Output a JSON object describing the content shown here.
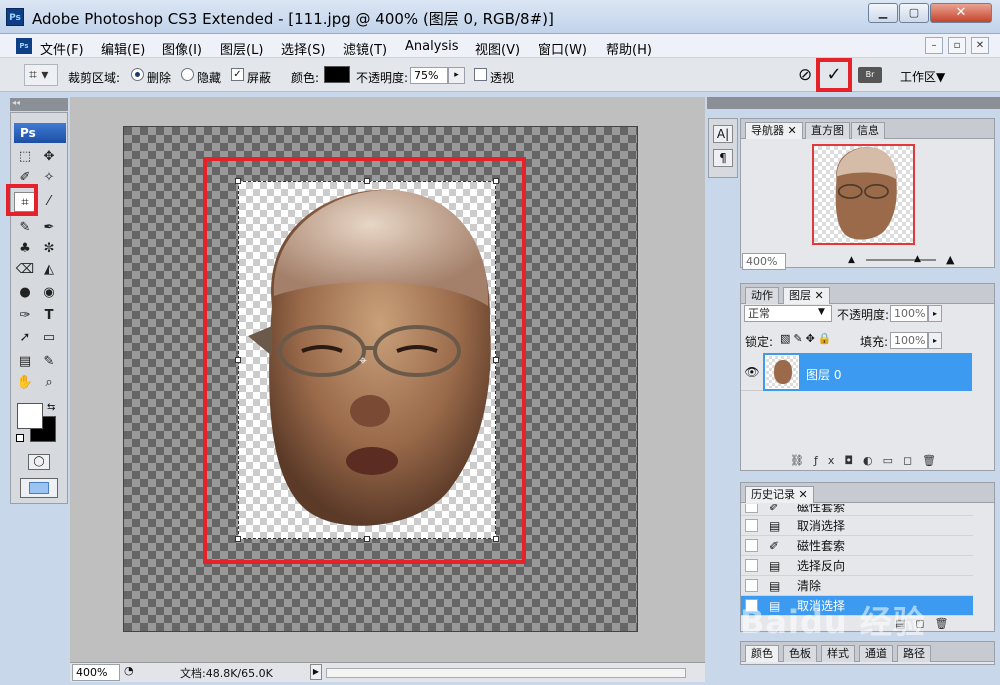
{
  "window": {
    "app_icon": "Ps",
    "title": "Adobe Photoshop CS3 Extended - [111.jpg @ 400% (图层 0, RGB/8#)]",
    "minimize_icon": "minimize-icon",
    "maximize_icon": "maximize-icon",
    "close_icon": "close-icon"
  },
  "menu": {
    "doc_icon": "Ps",
    "items": [
      "文件(F)",
      "编辑(E)",
      "图像(I)",
      "图层(L)",
      "选择(S)",
      "滤镜(T)",
      "Analysis",
      "视图(V)",
      "窗口(W)",
      "帮助(H)"
    ],
    "mdi": [
      "–",
      "▫",
      "✕"
    ]
  },
  "options_bar": {
    "crop_area_label": "裁剪区域:",
    "delete_label": "删除",
    "hide_label": "隐藏",
    "shield_label": "屏蔽",
    "color_label": "颜色:",
    "color_value": "#000000",
    "opacity_label": "不透明度:",
    "opacity_value": "75%",
    "perspective_label": "透视",
    "cancel_icon": "⊘",
    "commit_icon": "✓",
    "workspace_label": "工作区▼"
  },
  "tools_panel": {
    "header": "◂◂",
    "logo": "Ps",
    "tools": [
      [
        "⬚",
        "✥"
      ],
      [
        "✐",
        "✧"
      ],
      [
        "⌗",
        "⁄"
      ],
      [
        "✎",
        "✒"
      ],
      [
        "♣",
        "✼"
      ],
      [
        "⌫",
        "◭"
      ],
      [
        "●",
        "◉"
      ],
      [
        "✑",
        "T"
      ],
      [
        "➚",
        "▭"
      ],
      [
        "▤",
        "✎"
      ],
      [
        "✋",
        "⌕"
      ]
    ]
  },
  "navigator": {
    "tabs": [
      "导航器",
      "直方图",
      "信息"
    ],
    "zoom": "400%"
  },
  "layers": {
    "tabs": [
      "动作",
      "图层"
    ],
    "blend_mode": "正常",
    "opacity_label": "不透明度:",
    "opacity_value": "100%",
    "lock_label": "锁定:",
    "fill_label": "填充:",
    "fill_value": "100%",
    "layer_name": "图层 0"
  },
  "history": {
    "tab": "历史记录",
    "items": [
      {
        "icon": "lasso-icon",
        "label": "磁性套索",
        "active": false
      },
      {
        "icon": "doc-icon",
        "label": "取消选择",
        "active": false
      },
      {
        "icon": "lasso-icon",
        "label": "磁性套索",
        "active": false
      },
      {
        "icon": "doc-icon",
        "label": "选择反向",
        "active": false
      },
      {
        "icon": "doc-icon",
        "label": "清除",
        "active": false
      },
      {
        "icon": "doc-icon",
        "label": "取消选择",
        "active": true
      }
    ]
  },
  "bottom_panel": {
    "tabs": [
      "颜色",
      "色板",
      "样式",
      "通道",
      "路径"
    ]
  },
  "status": {
    "zoom": "400%",
    "doc_info": "文档:48.8K/65.0K"
  },
  "watermark": "Baidu 经验",
  "colors": {
    "highlight": "#3c9bf0",
    "annotation_red": "#e5212a"
  }
}
